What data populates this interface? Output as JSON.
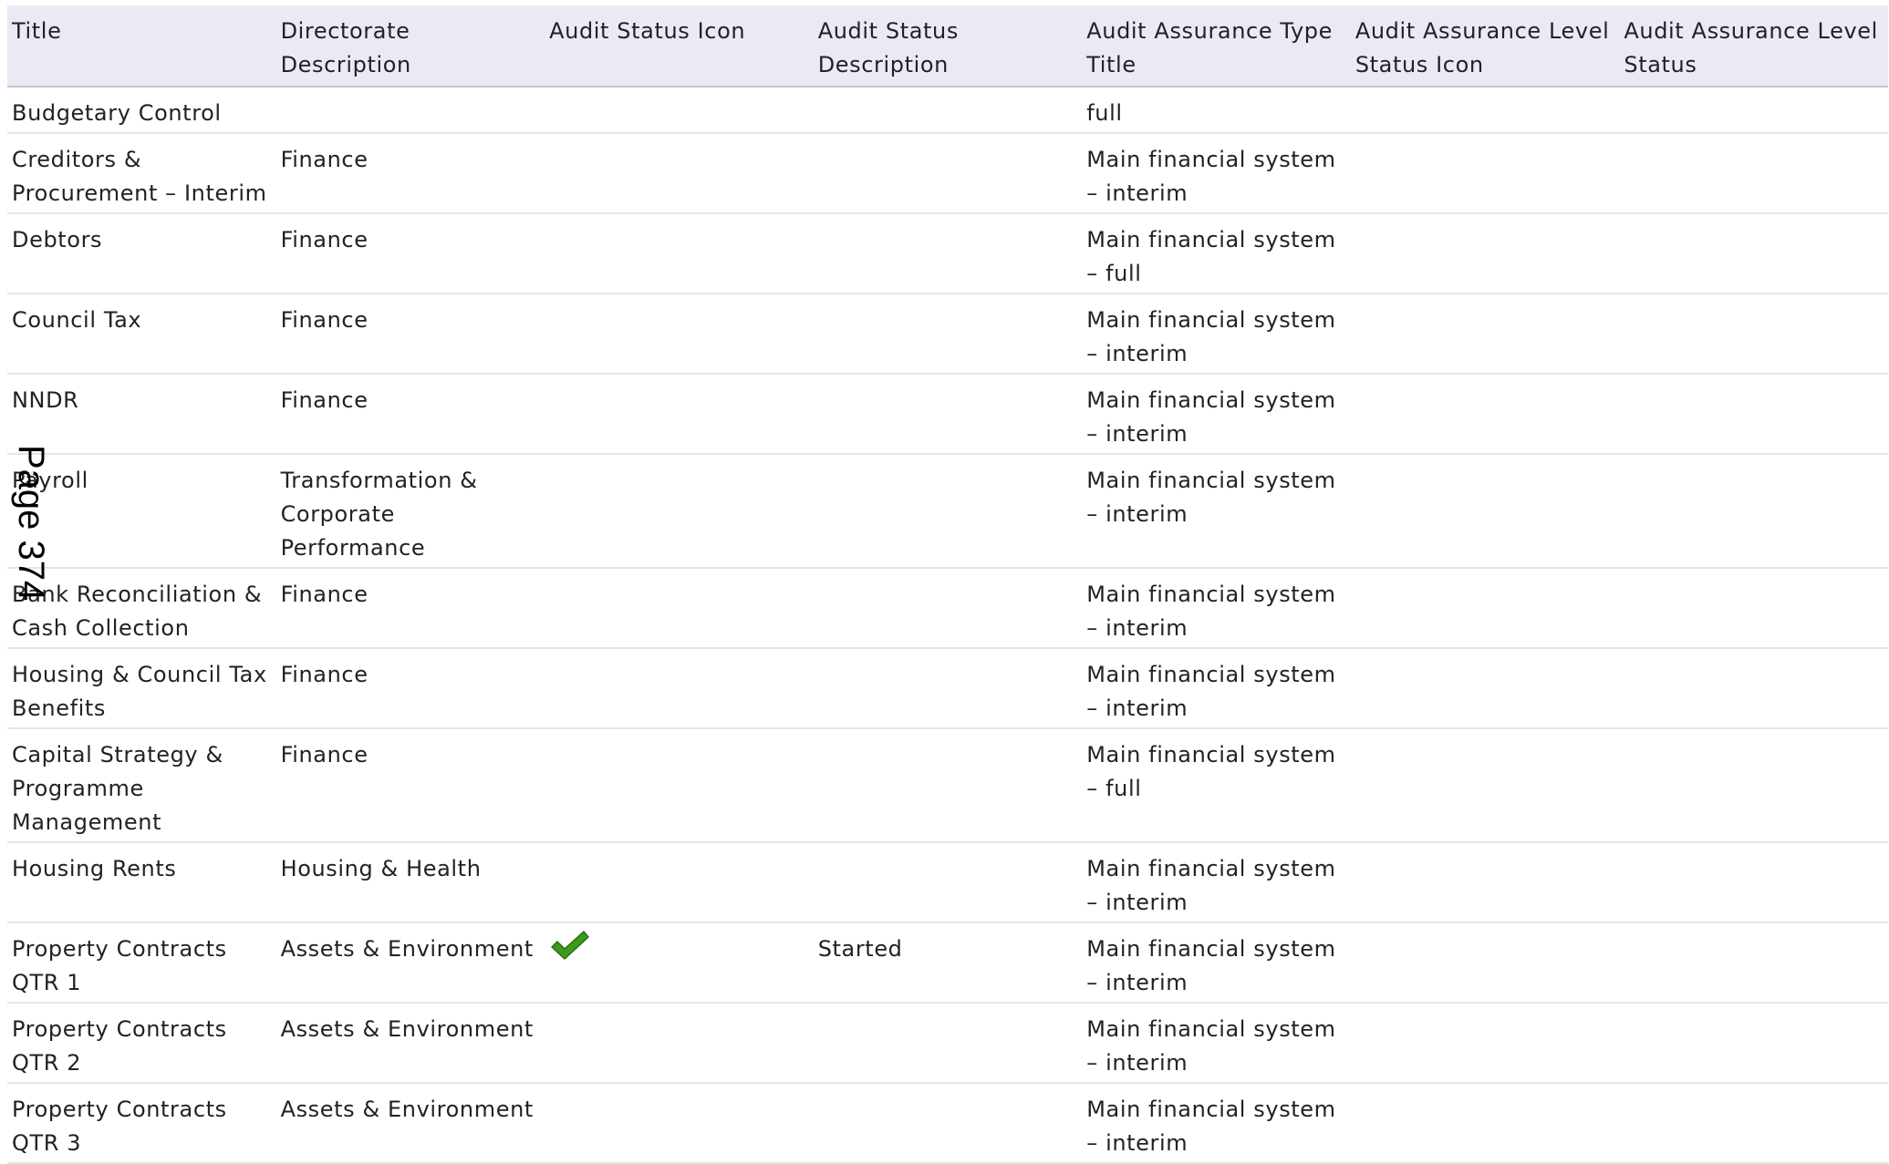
{
  "table": {
    "headers": [
      "Title",
      "Directorate Description",
      "Audit Status Icon",
      "Audit Status Description",
      "Audit Assurance Type Title",
      "Audit Assurance Level Status Icon",
      "Audit Assurance Level Status"
    ],
    "rows": [
      {
        "title": "Budgetary Control",
        "directorate": "",
        "status_icon": "",
        "status_description": "",
        "assurance_type": "full",
        "assurance_level_icon": "",
        "assurance_level_status": ""
      },
      {
        "title": "Creditors & Procurement – Interim",
        "directorate": "Finance",
        "status_icon": "",
        "status_description": "",
        "assurance_type": "Main financial system – interim",
        "assurance_level_icon": "",
        "assurance_level_status": ""
      },
      {
        "title": "Debtors",
        "directorate": "Finance",
        "status_icon": "",
        "status_description": "",
        "assurance_type": "Main financial system – full",
        "assurance_level_icon": "",
        "assurance_level_status": ""
      },
      {
        "title": "Council Tax",
        "directorate": "Finance",
        "status_icon": "",
        "status_description": "",
        "assurance_type": "Main financial system – interim",
        "assurance_level_icon": "",
        "assurance_level_status": ""
      },
      {
        "title": "NNDR",
        "directorate": "Finance",
        "status_icon": "",
        "status_description": "",
        "assurance_type": "Main financial system – interim",
        "assurance_level_icon": "",
        "assurance_level_status": ""
      },
      {
        "title": "Payroll",
        "directorate": "Transformation & Corporate Performance",
        "status_icon": "",
        "status_description": "",
        "assurance_type": "Main financial system – interim",
        "assurance_level_icon": "",
        "assurance_level_status": ""
      },
      {
        "title": "Bank Reconciliation & Cash Collection",
        "directorate": "Finance",
        "status_icon": "",
        "status_description": "",
        "assurance_type": "Main financial system – interim",
        "assurance_level_icon": "",
        "assurance_level_status": ""
      },
      {
        "title": "Housing & Council Tax Benefits",
        "directorate": "Finance",
        "status_icon": "",
        "status_description": "",
        "assurance_type": "Main financial system – interim",
        "assurance_level_icon": "",
        "assurance_level_status": ""
      },
      {
        "title": "Capital Strategy & Programme Management",
        "directorate": "Finance",
        "status_icon": "",
        "status_description": "",
        "assurance_type": "Main financial system – full",
        "assurance_level_icon": "",
        "assurance_level_status": ""
      },
      {
        "title": "Housing Rents",
        "directorate": "Housing & Health",
        "status_icon": "",
        "status_description": "",
        "assurance_type": "Main financial system – interim",
        "assurance_level_icon": "",
        "assurance_level_status": ""
      },
      {
        "title": "Property Contracts QTR 1",
        "directorate": "Assets & Environment",
        "status_icon": "green-check-icon",
        "status_description": "Started",
        "assurance_type": "Main financial system – interim",
        "assurance_level_icon": "",
        "assurance_level_status": ""
      },
      {
        "title": "Property Contracts QTR 2",
        "directorate": "Assets & Environment",
        "status_icon": "",
        "status_description": "",
        "assurance_type": "Main financial system – interim",
        "assurance_level_icon": "",
        "assurance_level_status": ""
      },
      {
        "title": "Property Contracts QTR 3",
        "directorate": "Assets & Environment",
        "status_icon": "",
        "status_description": "",
        "assurance_type": "Main financial system – interim",
        "assurance_level_icon": "",
        "assurance_level_status": ""
      }
    ]
  },
  "page_label": "Page 374",
  "colors": {
    "header_background": "#e9eaf4",
    "check_icon": "#3c9a1e"
  }
}
